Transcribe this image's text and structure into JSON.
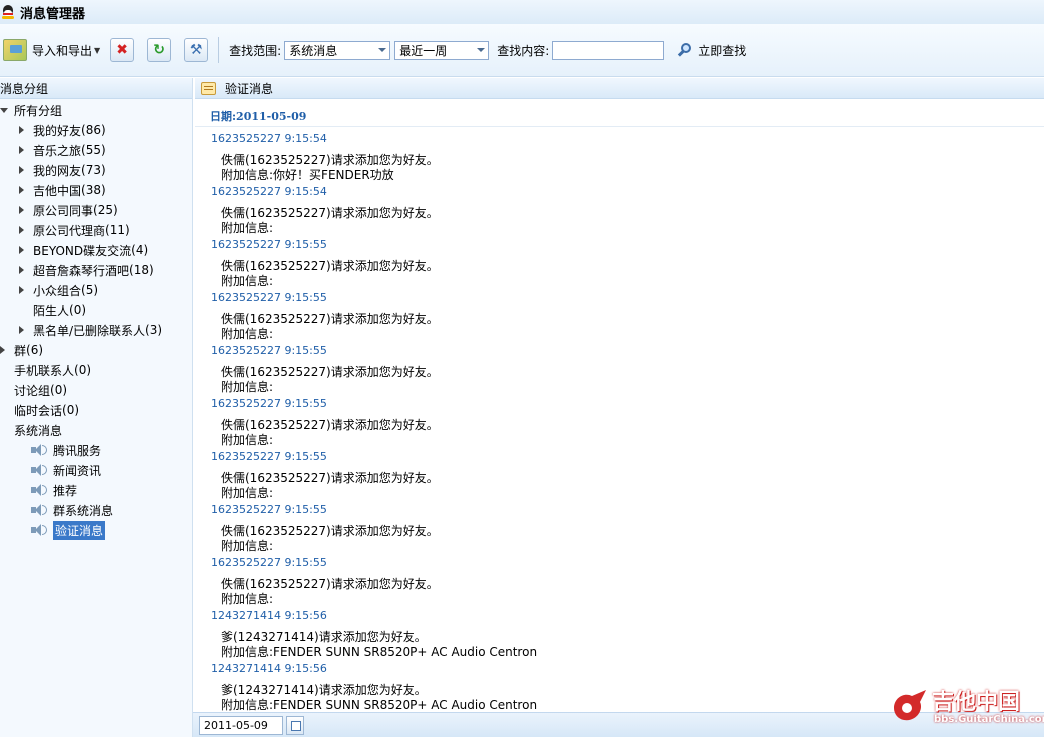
{
  "window": {
    "title": "消息管理器"
  },
  "toolbar": {
    "import_export_label": "导入和导出",
    "scope_label": "查找范围:",
    "scope_value": "系统消息",
    "time_value": "最近一周",
    "content_label": "查找内容:",
    "content_value": "",
    "search_label": "立即查找"
  },
  "sidebar": {
    "header": "消息分组",
    "all_groups": "所有分组",
    "groups": [
      {
        "label": "我的好友",
        "count": "(86)"
      },
      {
        "label": "音乐之旅",
        "count": "(55)"
      },
      {
        "label": "我的网友",
        "count": "(73)"
      },
      {
        "label": "吉他中国",
        "count": "(38)"
      },
      {
        "label": "原公司同事",
        "count": "(25)"
      },
      {
        "label": "原公司代理商",
        "count": "(11)"
      },
      {
        "label": "BEYOND碟友交流",
        "count": "(4)"
      },
      {
        "label": "超音詹森琴行酒吧",
        "count": "(18)"
      },
      {
        "label": "小众组合",
        "count": "(5)"
      },
      {
        "label": "陌生人",
        "count": "(0)"
      },
      {
        "label": "黑名单/已删除联系人",
        "count": "(3)"
      }
    ],
    "top_items": [
      {
        "label": "群",
        "count": "(6)"
      },
      {
        "label": "手机联系人",
        "count": "(0)"
      },
      {
        "label": "讨论组",
        "count": "(0)"
      },
      {
        "label": "临时会话",
        "count": "(0)"
      },
      {
        "label": "系统消息",
        "count": ""
      }
    ],
    "system_items": [
      "腾讯服务",
      "新闻资讯",
      "推荐",
      "群系统消息",
      "验证消息"
    ]
  },
  "content": {
    "header": "验证消息",
    "date_label": "日期:2011-05-09",
    "messages": [
      {
        "head": "1623525227  9:15:54",
        "line1": "佚儒(1623525227)请求添加您为好友。",
        "line2": "附加信息:你好！买FENDER功放"
      },
      {
        "head": "1623525227  9:15:54",
        "line1": "佚儒(1623525227)请求添加您为好友。",
        "line2": "附加信息:"
      },
      {
        "head": "1623525227  9:15:55",
        "line1": "佚儒(1623525227)请求添加您为好友。",
        "line2": "附加信息:"
      },
      {
        "head": "1623525227  9:15:55",
        "line1": "佚儒(1623525227)请求添加您为好友。",
        "line2": "附加信息:"
      },
      {
        "head": "1623525227  9:15:55",
        "line1": "佚儒(1623525227)请求添加您为好友。",
        "line2": "附加信息:"
      },
      {
        "head": "1623525227  9:15:55",
        "line1": "佚儒(1623525227)请求添加您为好友。",
        "line2": "附加信息:"
      },
      {
        "head": "1623525227  9:15:55",
        "line1": "佚儒(1623525227)请求添加您为好友。",
        "line2": "附加信息:"
      },
      {
        "head": "1623525227  9:15:55",
        "line1": "佚儒(1623525227)请求添加您为好友。",
        "line2": "附加信息:"
      },
      {
        "head": "1623525227  9:15:55",
        "line1": "佚儒(1623525227)请求添加您为好友。",
        "line2": "附加信息:"
      },
      {
        "head": "1243271414  9:15:56",
        "line1": "爹(1243271414)请求添加您为好友。",
        "line2": "附加信息:FENDER SUNN SR8520P+ AC Audio Centron"
      },
      {
        "head": "1243271414  9:15:56",
        "line1": "爹(1243271414)请求添加您为好友。",
        "line2": "附加信息:FENDER SUNN SR8520P+ AC Audio Centron"
      }
    ]
  },
  "footer": {
    "date_value": "2011-05-09"
  },
  "watermark": {
    "text": "吉他中国",
    "url": "bbs.GuitarChina.com"
  },
  "colors": {
    "accent": "#1f5ea8",
    "selected": "#3a79c9",
    "panel": "#f4f9fe"
  }
}
